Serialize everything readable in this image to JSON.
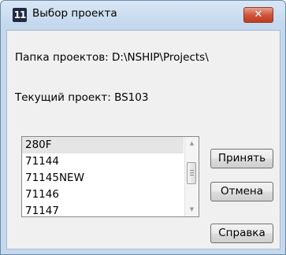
{
  "window": {
    "title": "Выбор проекта",
    "app_icon_text": "11",
    "close_glyph": "✕"
  },
  "labels": {
    "projects_folder": "Папка проектов: D:\\NSHIP\\Projects\\",
    "current_project": "Текущий проект: BS103"
  },
  "project_list": {
    "items": [
      "280F",
      "71144",
      "71145NEW",
      "71146",
      "71147"
    ],
    "selected": "280F",
    "scroll_up_glyph": "▲",
    "scroll_down_glyph": "▼"
  },
  "buttons": {
    "accept": "Принять",
    "cancel": "Отмена",
    "help": "Справка"
  },
  "colors": {
    "title_gradient_top": "#d9e7f5",
    "close_button": "#d0553b",
    "selected_item": "#e5e5e5"
  }
}
